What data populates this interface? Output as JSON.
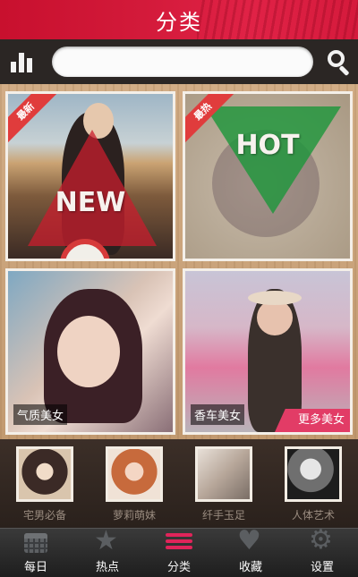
{
  "header": {
    "title": "分类"
  },
  "search": {
    "placeholder": "",
    "value": ""
  },
  "tiles": [
    {
      "badge": "最新",
      "overlay": "NEW"
    },
    {
      "badge": "最热",
      "overlay": "HOT"
    },
    {
      "caption": "气质美女"
    },
    {
      "caption": "香车美女",
      "more": "更多美女"
    }
  ],
  "thumbnails": [
    {
      "label": "宅男必备"
    },
    {
      "label": "萝莉萌妹"
    },
    {
      "label": "纤手玉足"
    },
    {
      "label": "人体艺术"
    }
  ],
  "nav": [
    {
      "label": "每日",
      "icon": "calendar-icon"
    },
    {
      "label": "热点",
      "icon": "star-icon"
    },
    {
      "label": "分类",
      "icon": "list-icon",
      "active": true
    },
    {
      "label": "收藏",
      "icon": "heart-icon"
    },
    {
      "label": "设置",
      "icon": "gear-icon"
    }
  ],
  "colors": {
    "header": "#d31a3a",
    "accent": "#e0245a",
    "hot": "#1e963c",
    "new": "#c81e2d"
  }
}
